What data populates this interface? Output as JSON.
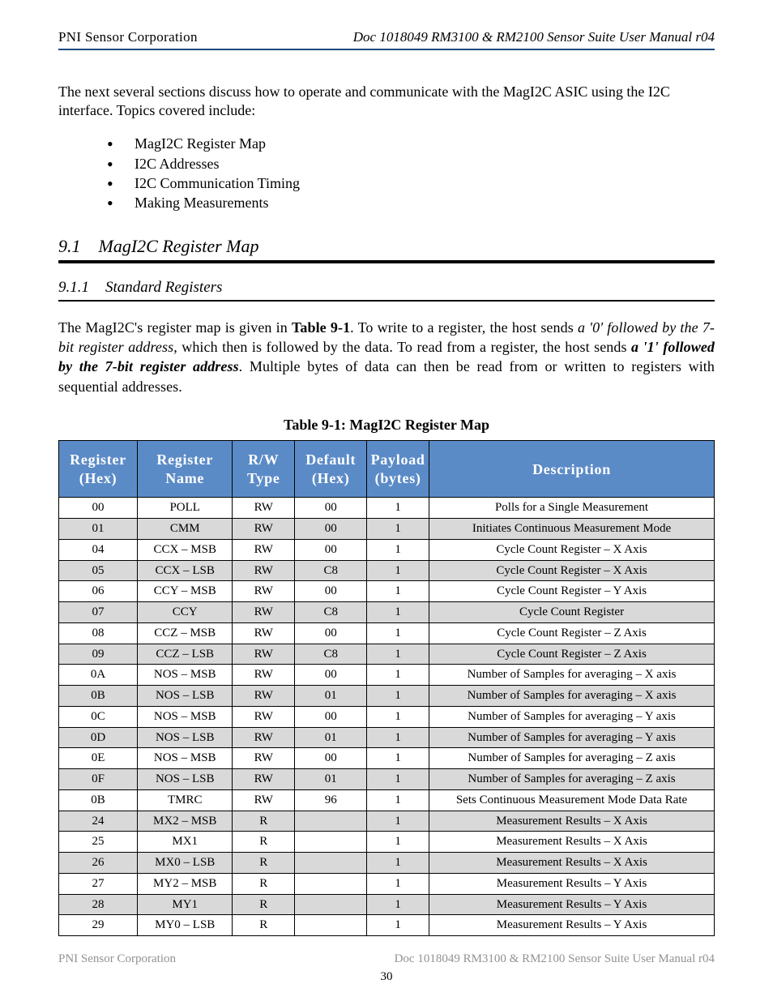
{
  "header": {
    "left": "PNI Sensor Corporation",
    "right": "Doc 1018049 RM3100 & RM2100 Sensor Suite User Manual r04"
  },
  "intro": "The next several sections discuss how to operate and communicate with the MagI2C ASIC using the I2C interface. Topics covered include:",
  "bullets": [
    "MagI2C Register Map",
    "I2C Addresses",
    "I2C Communication Timing",
    "Making Measurements"
  ],
  "section": {
    "number": "9.1",
    "title": "MagI2C Register Map"
  },
  "subsection": {
    "number": "9.1.1",
    "title": "Standard Registers"
  },
  "regmap": {
    "sentence1a": "The MagI2C's register map is given in ",
    "table_ref": "Table 9-1",
    "sentence1b": ". To write to a register, the host sends ",
    "write_prefix": "a '0' followed by the 7-bit register address",
    "sentence1c": ", which then is followed by the data. To read from a register, the host sends ",
    "read_prefix": "a '1' followed by the 7-bit register address",
    "sentence1d": ". Multiple bytes of data can then be read from or written to registers with sequential addresses."
  },
  "table": {
    "caption": "Table 9-1: MagI2C Register Map",
    "headers": [
      "Register (Hex)",
      "Register Name",
      "R/W Type",
      "Default (Hex)",
      "Payload (bytes)",
      "Description"
    ],
    "rows": [
      {
        "addr": "00",
        "name": "POLL",
        "type": "RW",
        "def": "00",
        "len": "1",
        "desc": "Polls for a Single Measurement"
      },
      {
        "addr": "01",
        "name": "CMM",
        "type": "RW",
        "def": "00",
        "len": "1",
        "desc": "Initiates Continuous Measurement Mode"
      },
      {
        "addr": "04",
        "name": "CCX – MSB",
        "type": "RW",
        "def": "00",
        "len": "1",
        "desc": "Cycle Count Register – X Axis"
      },
      {
        "addr": "05",
        "name": "CCX – LSB",
        "type": "RW",
        "def": "C8",
        "len": "1",
        "desc": "Cycle Count Register – X Axis"
      },
      {
        "addr": "06",
        "name": "CCY – MSB",
        "type": "RW",
        "def": "00",
        "len": "1",
        "desc": "Cycle Count Register – Y Axis"
      },
      {
        "addr": "07",
        "name": "CCY",
        "type": "RW",
        "def": "C8",
        "len": "1",
        "desc": "Cycle Count Register"
      },
      {
        "addr": "08",
        "name": "CCZ – MSB",
        "type": "RW",
        "def": "00",
        "len": "1",
        "desc": "Cycle Count Register – Z Axis"
      },
      {
        "addr": "09",
        "name": "CCZ – LSB",
        "type": "RW",
        "def": "C8",
        "len": "1",
        "desc": "Cycle Count Register – Z Axis"
      },
      {
        "addr": "0A",
        "name": "NOS – MSB",
        "type": "RW",
        "def": "00",
        "len": "1",
        "desc": "Number of Samples for averaging – X axis"
      },
      {
        "addr": "0B",
        "name": "NOS – LSB",
        "type": "RW",
        "def": "01",
        "len": "1",
        "desc": "Number of Samples for averaging – X axis"
      },
      {
        "addr": "0C",
        "name": "NOS – MSB",
        "type": "RW",
        "def": "00",
        "len": "1",
        "desc": "Number of Samples for averaging – Y axis"
      },
      {
        "addr": "0D",
        "name": "NOS – LSB",
        "type": "RW",
        "def": "01",
        "len": "1",
        "desc": "Number of Samples for averaging – Y axis"
      },
      {
        "addr": "0E",
        "name": "NOS – MSB",
        "type": "RW",
        "def": "00",
        "len": "1",
        "desc": "Number of Samples for averaging – Z axis"
      },
      {
        "addr": "0F",
        "name": "NOS – LSB",
        "type": "RW",
        "def": "01",
        "len": "1",
        "desc": "Number of Samples for averaging – Z axis"
      },
      {
        "addr": "0B",
        "name": "TMRC",
        "type": "RW",
        "def": "96",
        "len": "1",
        "desc": "Sets Continuous Measurement Mode Data Rate"
      },
      {
        "addr": "24",
        "name": "MX2 – MSB",
        "type": "R",
        "def": "",
        "len": "1",
        "desc": "Measurement Results – X Axis"
      },
      {
        "addr": "25",
        "name": "MX1",
        "type": "R",
        "def": "",
        "len": "1",
        "desc": "Measurement Results – X Axis"
      },
      {
        "addr": "26",
        "name": "MX0 – LSB",
        "type": "R",
        "def": "",
        "len": "1",
        "desc": "Measurement Results – X Axis"
      },
      {
        "addr": "27",
        "name": "MY2 – MSB",
        "type": "R",
        "def": "",
        "len": "1",
        "desc": "Measurement Results – Y Axis"
      },
      {
        "addr": "28",
        "name": "MY1",
        "type": "R",
        "def": "",
        "len": "1",
        "desc": "Measurement Results – Y Axis"
      },
      {
        "addr": "29",
        "name": "MY0 – LSB",
        "type": "R",
        "def": "",
        "len": "1",
        "desc": "Measurement Results – Y Axis"
      }
    ]
  },
  "footer": {
    "left": "PNI Sensor Corporation",
    "right": "Doc 1018049 RM3100 & RM2100 Sensor Suite User Manual r04",
    "page": "30"
  }
}
